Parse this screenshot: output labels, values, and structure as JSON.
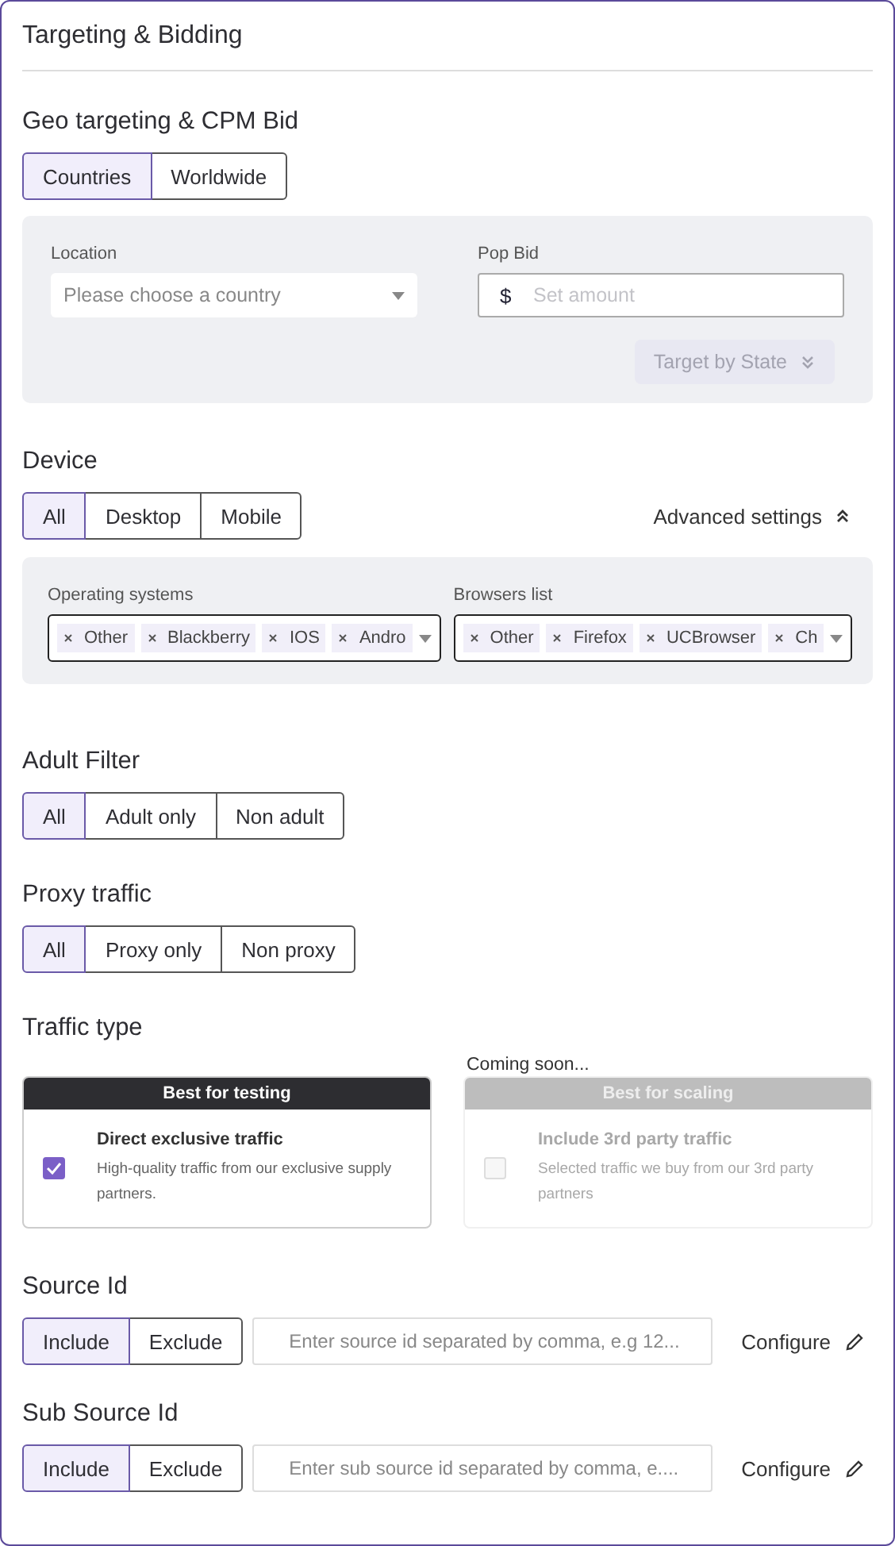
{
  "panel": {
    "title": "Targeting & Bidding"
  },
  "geo": {
    "heading": "Geo targeting & CPM Bid",
    "options": [
      {
        "label": "Countries",
        "selected": true
      },
      {
        "label": "Worldwide",
        "selected": false
      }
    ],
    "location": {
      "label": "Location",
      "placeholder": "Please choose a country"
    },
    "pop_bid": {
      "label": "Pop Bid",
      "currency": "$",
      "placeholder": "Set amount"
    },
    "target_by_state": {
      "label": "Target by State",
      "disabled": true
    }
  },
  "device": {
    "heading": "Device",
    "options": [
      {
        "label": "All",
        "selected": true
      },
      {
        "label": "Desktop",
        "selected": false
      },
      {
        "label": "Mobile",
        "selected": false
      }
    ],
    "advanced": {
      "label": "Advanced settings",
      "expanded": true
    },
    "os": {
      "label": "Operating systems",
      "tags": [
        "Other",
        "Blackberry",
        "IOS",
        "Andro"
      ]
    },
    "browsers": {
      "label": "Browsers list",
      "tags": [
        "Other",
        "Firefox",
        "UCBrowser",
        "Ch"
      ]
    }
  },
  "adult_filter": {
    "heading": "Adult Filter",
    "options": [
      {
        "label": "All",
        "selected": true
      },
      {
        "label": "Adult only",
        "selected": false
      },
      {
        "label": "Non adult",
        "selected": false
      }
    ]
  },
  "proxy_traffic": {
    "heading": "Proxy traffic",
    "options": [
      {
        "label": "All",
        "selected": true
      },
      {
        "label": "Proxy only",
        "selected": false
      },
      {
        "label": "Non proxy",
        "selected": false
      }
    ]
  },
  "traffic_type": {
    "heading": "Traffic type",
    "cards": [
      {
        "banner": "Best for testing",
        "title": "Direct exclusive traffic",
        "description": "High-quality traffic from our exclusive supply partners.",
        "checked": true,
        "disabled": false
      },
      {
        "note": "Coming soon...",
        "banner": "Best for scaling",
        "title": "Include 3rd party traffic",
        "description": "Selected traffic we buy from our 3rd party partners",
        "checked": false,
        "disabled": true
      }
    ]
  },
  "source_id": {
    "heading": "Source Id",
    "options": [
      {
        "label": "Include",
        "selected": true
      },
      {
        "label": "Exclude",
        "selected": false
      }
    ],
    "placeholder": "Enter source id separated by comma, e.g 12...",
    "configure": "Configure"
  },
  "sub_source_id": {
    "heading": "Sub Source Id",
    "options": [
      {
        "label": "Include",
        "selected": true
      },
      {
        "label": "Exclude",
        "selected": false
      }
    ],
    "placeholder": "Enter sub source id separated by comma, e....",
    "configure": "Configure"
  }
}
